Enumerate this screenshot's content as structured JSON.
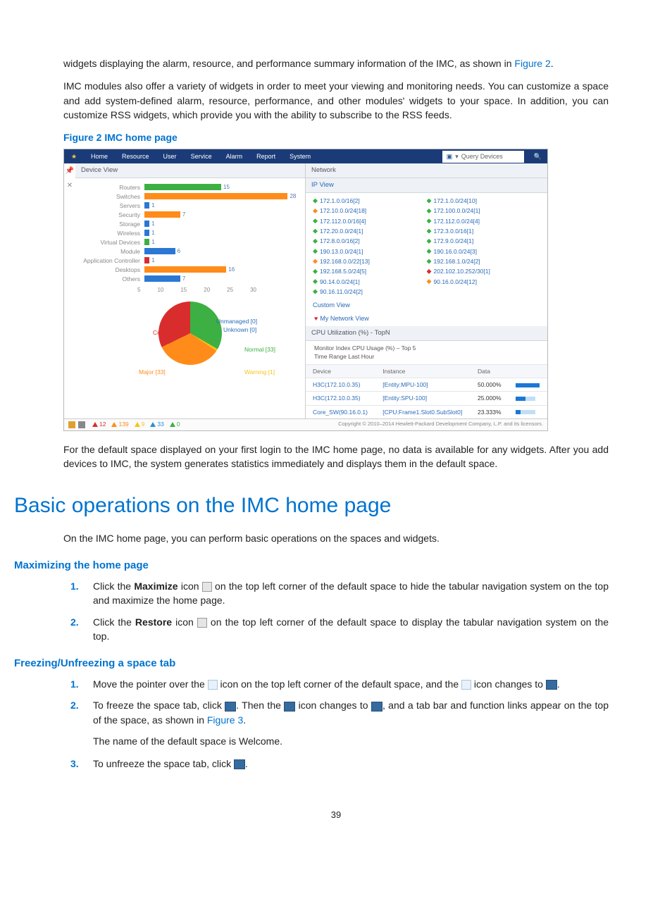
{
  "intro_para": "widgets displaying the alarm, resource, and performance summary information of the IMC, as shown in ",
  "intro_fig_link": "Figure 2",
  "intro_period": ".",
  "para2": "IMC modules also offer a variety of widgets in order to meet your viewing and monitoring needs. You can customize a space and add system-defined alarm, resource, performance, and other modules' widgets to your space. In addition, you can customize RSS widgets, which provide you with the ability to subscribe to the RSS feeds.",
  "fig2_caption": "Figure 2 IMC home page",
  "menu": {
    "items": [
      "Home",
      "Resource",
      "User",
      "Service",
      "Alarm",
      "Report",
      "System"
    ],
    "query_placeholder": "Query Devices"
  },
  "left_panel_title": "Device View",
  "chart_data": {
    "type": "bar",
    "xlim": [
      0,
      30
    ],
    "ticks": [
      5,
      10,
      15,
      20,
      25,
      30
    ],
    "series": [
      {
        "name": "Routers",
        "value": 15,
        "color": "#3cb043"
      },
      {
        "name": "Switches",
        "value": 28,
        "color": "#ff8c1a"
      },
      {
        "name": "Servers",
        "value": 1,
        "color": "#2a78d4"
      },
      {
        "name": "Security",
        "value": 7,
        "color": "#ff8c1a"
      },
      {
        "name": "Storage",
        "value": 1,
        "color": "#2a78d4"
      },
      {
        "name": "Wireless",
        "value": 1,
        "color": "#2a78d4"
      },
      {
        "name": "Virtual Devices",
        "value": 1,
        "color": "#3cb043"
      },
      {
        "name": "Module",
        "value": 6,
        "color": "#2a78d4"
      },
      {
        "name": "Application Controller",
        "value": 1,
        "color": "#d92d2d"
      },
      {
        "name": "Desktops",
        "value": 16,
        "color": "#ff8c1a"
      },
      {
        "name": "Others",
        "value": 7,
        "color": "#2a78d4"
      }
    ]
  },
  "pie_labels": {
    "critical": "Critical [13]",
    "major": "Major [33]",
    "unmanaged": "Unmanaged [0]",
    "unknown": "Unknown [0]",
    "normal": "Normal [33]",
    "warning": "Warning [1]"
  },
  "right_top_title": "Network",
  "right_ip_title": "IP View",
  "ip_left": [
    {
      "t": "172.1.0.0/16[2]"
    },
    {
      "t": "172.10.0.0/24[18]",
      "cls": "orange"
    },
    {
      "t": "172.112.0.0/16[4]"
    },
    {
      "t": "172.20.0.0/24[1]"
    },
    {
      "t": "172.8.0.0/16[2]"
    },
    {
      "t": "190.13.0.0/24[1]"
    },
    {
      "t": "192.168.0.0/22[13]",
      "cls": "orange"
    },
    {
      "t": "192.168.5.0/24[5]"
    },
    {
      "t": "90.14.0.0/24[1]"
    },
    {
      "t": "90.16.11.0/24[2]"
    }
  ],
  "ip_right": [
    {
      "t": "172.1.0.0/24[10]"
    },
    {
      "t": "172.100.0.0/24[1]"
    },
    {
      "t": "172.112.0.0/24[4]"
    },
    {
      "t": "172.3.0.0/16[1]"
    },
    {
      "t": "172.9.0.0/24[1]"
    },
    {
      "t": "190.16.0.0/24[3]"
    },
    {
      "t": "192.168.1.0/24[2]"
    },
    {
      "t": "202.102.10.252/30[1]",
      "cls": "red"
    },
    {
      "t": "90.16.0.0/24[12]",
      "cls": "orange"
    }
  ],
  "custom_view": "Custom View",
  "my_net": "My Network View",
  "cpu_title": "CPU Utilization (%) - TopN",
  "cpu_meta1": "Monitor Index   CPU Usage (%) – Top 5",
  "cpu_meta2": "Time Range     Last Hour",
  "cpu_head": [
    "Device",
    "Instance",
    "Data",
    ""
  ],
  "cpu_rows": [
    {
      "d": "H3C(172.10.0.35)",
      "i": "[Entity:MPU-100]",
      "v": "50.000%",
      "bar": "full"
    },
    {
      "d": "H3C(172.10.0.35)",
      "i": "[Entity:SPU-100]",
      "v": "25.000%",
      "bar": "half"
    },
    {
      "d": "Core_SW(90.16.0.1)",
      "i": "[CPU:Frame1.Slot0.SubSlot0]",
      "v": "23.333%",
      "bar": "quarter"
    }
  ],
  "alarms": [
    {
      "cls": "crit",
      "t": "12"
    },
    {
      "cls": "maj",
      "t": "139"
    },
    {
      "cls": "min",
      "t": "9"
    },
    {
      "cls": "warn",
      "t": "33"
    },
    {
      "cls": "info",
      "t": "0"
    }
  ],
  "copyright": "Copyright © 2010–2014 Hewlett-Packard Development Company, L.P. and its licensors.",
  "after_fig": "For the default space displayed on your first login to the IMC home page, no data is available for any widgets. After you add devices to IMC, the system generates statistics immediately and displays them in the default space.",
  "h1": "Basic operations on the IMC home page",
  "h1_p": "On the IMC home page, you can perform basic operations on the spaces and widgets.",
  "maximize_h": "Maximizing the home page",
  "max_steps": [
    {
      "n": "1.",
      "pre": "Click the ",
      "b": "Maximize",
      "mid": " icon ",
      "post": " on the top left corner of the default space to hide the tabular navigation system on the top and maximize the home page.",
      "icon": "small-grey"
    },
    {
      "n": "2.",
      "pre": "Click the ",
      "b": "Restore",
      "mid": " icon ",
      "post": " on the top left corner of the default space to display the tabular navigation system on the top.",
      "icon": "small-grey"
    }
  ],
  "freeze_h": "Freezing/Unfreezing a space tab",
  "fr1": {
    "n": "1.",
    "t1": "Move the pointer over the ",
    "t2": " icon on the top left corner of the default space, and the ",
    "t3": " icon changes to ",
    "t4": "."
  },
  "fr2": {
    "n": "2.",
    "t1": "To freeze the space tab, click ",
    "t2": ". Then the ",
    "t3": " icon changes to ",
    "t4": ", and a tab bar and function links appear on the top of the space, as shown in ",
    "link": "Figure 3",
    "t5": "."
  },
  "fr2_p2": "The name of the default space is Welcome.",
  "fr3": {
    "n": "3.",
    "t1": "To unfreeze the space tab, click ",
    "t2": "."
  },
  "page_number": "39"
}
